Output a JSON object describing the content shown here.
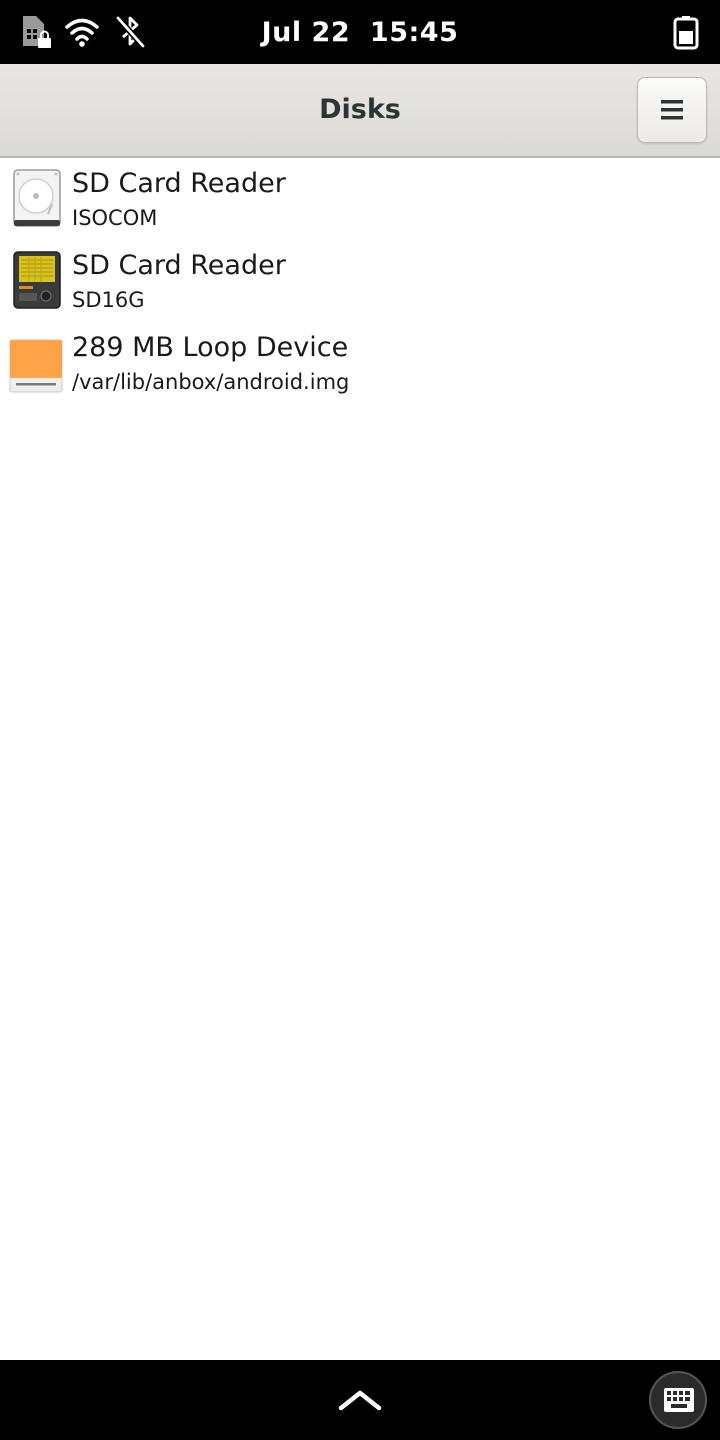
{
  "status_bar": {
    "date": "Jul 22",
    "time": "15:45",
    "icons": [
      "sim-locked-icon",
      "wifi-icon",
      "bluetooth-disabled-icon",
      "battery-icon"
    ]
  },
  "header": {
    "title": "Disks",
    "menu_icon": "hamburger-menu-icon"
  },
  "disks": [
    {
      "name": "SD Card Reader",
      "subtitle": "ISOCOM",
      "icon": "hard-disk-icon"
    },
    {
      "name": "SD Card Reader",
      "subtitle": "SD16G",
      "icon": "sd-card-icon"
    },
    {
      "name": "289 MB Loop Device",
      "subtitle": "/var/lib/anbox/android.img",
      "icon": "loop-device-icon"
    }
  ],
  "bottom_bar": {
    "handle_icon": "chevron-up-icon",
    "keyboard_icon": "keyboard-icon"
  },
  "colors": {
    "status_bar_bg": "#000000",
    "header_bg": "#e1dedb",
    "loop_device_orange": "#ffa348",
    "text": "#1a1a1a"
  }
}
